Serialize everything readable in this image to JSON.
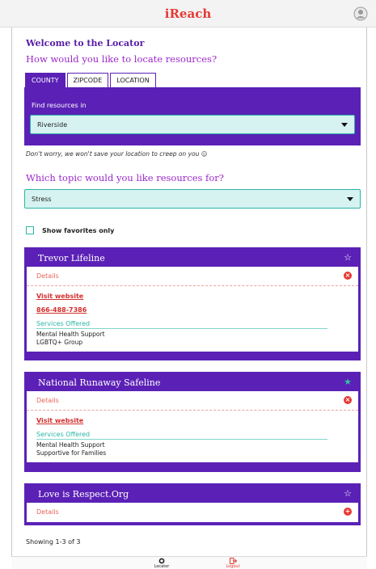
{
  "app": {
    "title": "iReach"
  },
  "locator": {
    "welcome": "Welcome to the Locator",
    "locate_question": "How would you like to locate resources?",
    "tabs": [
      "COUNTY",
      "ZIPCODE",
      "LOCATION"
    ],
    "active_tab": "COUNTY",
    "find_label": "Find resources in",
    "county_value": "Riverside",
    "privacy_note": "Don't worry, we won't save your location to creep on you ☺"
  },
  "topic": {
    "question": "Which topic would you like resources for?",
    "value": "Stress"
  },
  "favorites": {
    "label": "Show favorites only",
    "checked": false
  },
  "resources": [
    {
      "name": "Trevor Lifeline",
      "favorite": false,
      "details_label": "Details",
      "expanded": true,
      "website_label": "Visit website",
      "phone": "866-488-7386",
      "services_title": "Services Offered",
      "services": [
        "Mental Health Support",
        "LGBTQ+ Group"
      ]
    },
    {
      "name": "National Runaway Safeline",
      "favorite": true,
      "details_label": "Details",
      "expanded": true,
      "website_label": "Visit website",
      "services_title": "Services Offered",
      "services": [
        "Mental Health Support",
        "Supportive for Families"
      ]
    },
    {
      "name": "Love is Respect.Org",
      "favorite": false,
      "details_label": "Details",
      "expanded": false
    }
  ],
  "pagination": {
    "summary": "Showing 1-3 of 3"
  },
  "bottom_nav": [
    {
      "label": "Locator",
      "icon": "locator-icon",
      "active": false
    },
    {
      "label": "Logout",
      "icon": "logout-icon",
      "active": true
    }
  ],
  "colors": {
    "brand_purple": "#5b21b6",
    "heading_purple": "#9b27c9",
    "accent_red": "#e53935",
    "teal": "#29b6a6",
    "select_bg": "#d6f3f1"
  }
}
